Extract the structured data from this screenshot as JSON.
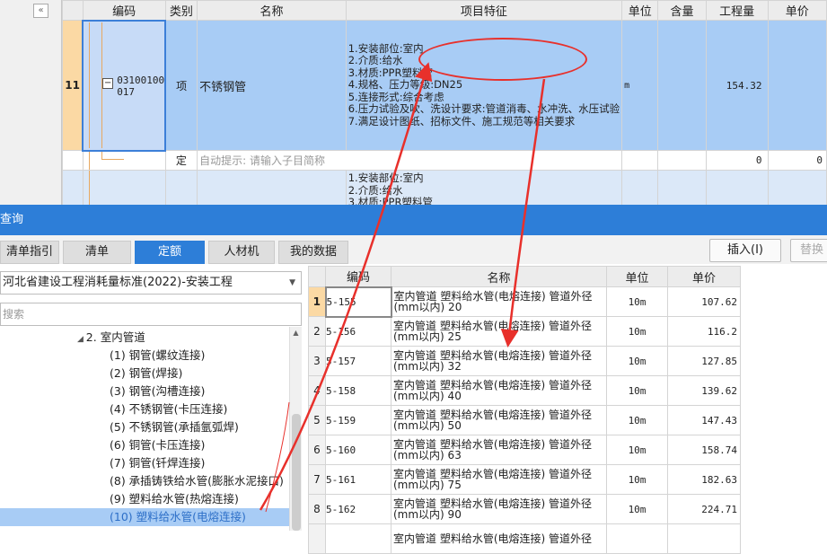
{
  "top_grid": {
    "headers": [
      "编码",
      "类别",
      "名称",
      "项目特征",
      "单位",
      "含量",
      "工程量",
      "单价"
    ],
    "row11": {
      "row_no": "11",
      "code": "031001003017",
      "type": "项",
      "name": "不锈钢管",
      "features": [
        "1.安装部位:室内",
        "2.介质:给水",
        "3.材质:PPR塑料管",
        "4.规格、压力等级:DN25",
        "5.连接形式:综合考虑",
        "6.压力试验及吹、洗设计要求:管道消毒、水冲洗、水压试验",
        "7.满足设计图纸、招标文件、施工规范等相关要求"
      ],
      "unit": "m",
      "quantity": "154.32"
    },
    "ding_row": {
      "type": "定",
      "name_hint": "自动提示: 请输入子目简称",
      "quantity": "0",
      "price": "0"
    },
    "next_row_features": [
      "1.安装部位:室内",
      "2.介质:给水",
      "3.材质:PPR塑料管"
    ]
  },
  "panel": {
    "title": "查询",
    "tabs": [
      "清单指引",
      "清单",
      "定额",
      "人材机",
      "我的数据"
    ],
    "active_tab": "定额",
    "insert_button": "插入(I)",
    "replace_button": "替换",
    "library": "河北省建设工程消耗量标准(2022)-安装工程",
    "search_placeholder": "搜索",
    "tree_parent": "2. 室内管道",
    "tree_items": [
      "(1) 钢管(螺纹连接)",
      "(2) 钢管(焊接)",
      "(3) 钢管(沟槽连接)",
      "(4) 不锈钢管(卡压连接)",
      "(5) 不锈钢管(承插氩弧焊)",
      "(6) 铜管(卡压连接)",
      "(7) 铜管(钎焊连接)",
      "(8) 承插铸铁给水管(膨胀水泥接口)",
      "(9) 塑料给水管(热熔连接)",
      "(10) 塑料给水管(电熔连接)"
    ]
  },
  "results": {
    "headers": [
      "编码",
      "名称",
      "单位",
      "单价"
    ],
    "rows": [
      {
        "no": "1",
        "code": "5-155",
        "name": "室内管道 塑料给水管(电熔连接) 管道外径(mm以内) 20",
        "unit": "10m",
        "price": "107.62"
      },
      {
        "no": "2",
        "code": "5-156",
        "name": "室内管道 塑料给水管(电熔连接) 管道外径(mm以内) 25",
        "unit": "10m",
        "price": "116.2"
      },
      {
        "no": "3",
        "code": "5-157",
        "name": "室内管道 塑料给水管(电熔连接) 管道外径(mm以内) 32",
        "unit": "10m",
        "price": "127.85"
      },
      {
        "no": "4",
        "code": "5-158",
        "name": "室内管道 塑料给水管(电熔连接) 管道外径(mm以内) 40",
        "unit": "10m",
        "price": "139.62"
      },
      {
        "no": "5",
        "code": "5-159",
        "name": "室内管道 塑料给水管(电熔连接) 管道外径(mm以内) 50",
        "unit": "10m",
        "price": "147.43"
      },
      {
        "no": "6",
        "code": "5-160",
        "name": "室内管道 塑料给水管(电熔连接) 管道外径(mm以内) 63",
        "unit": "10m",
        "price": "158.74"
      },
      {
        "no": "7",
        "code": "5-161",
        "name": "室内管道 塑料给水管(电熔连接) 管道外径(mm以内) 75",
        "unit": "10m",
        "price": "182.63"
      },
      {
        "no": "8",
        "code": "5-162",
        "name": "室内管道 塑料给水管(电熔连接) 管道外径(mm以内) 90",
        "unit": "10m",
        "price": "224.71"
      },
      {
        "no": "",
        "code": "",
        "name": "室内管道 塑料给水管(电熔连接) 管道外径",
        "unit": "",
        "price": ""
      }
    ]
  },
  "colors": {
    "accent": "#2d7ed8",
    "selected_row": "#a8ccf5",
    "header_selected": "#fbd9a4",
    "annotation": "#e8302b"
  }
}
